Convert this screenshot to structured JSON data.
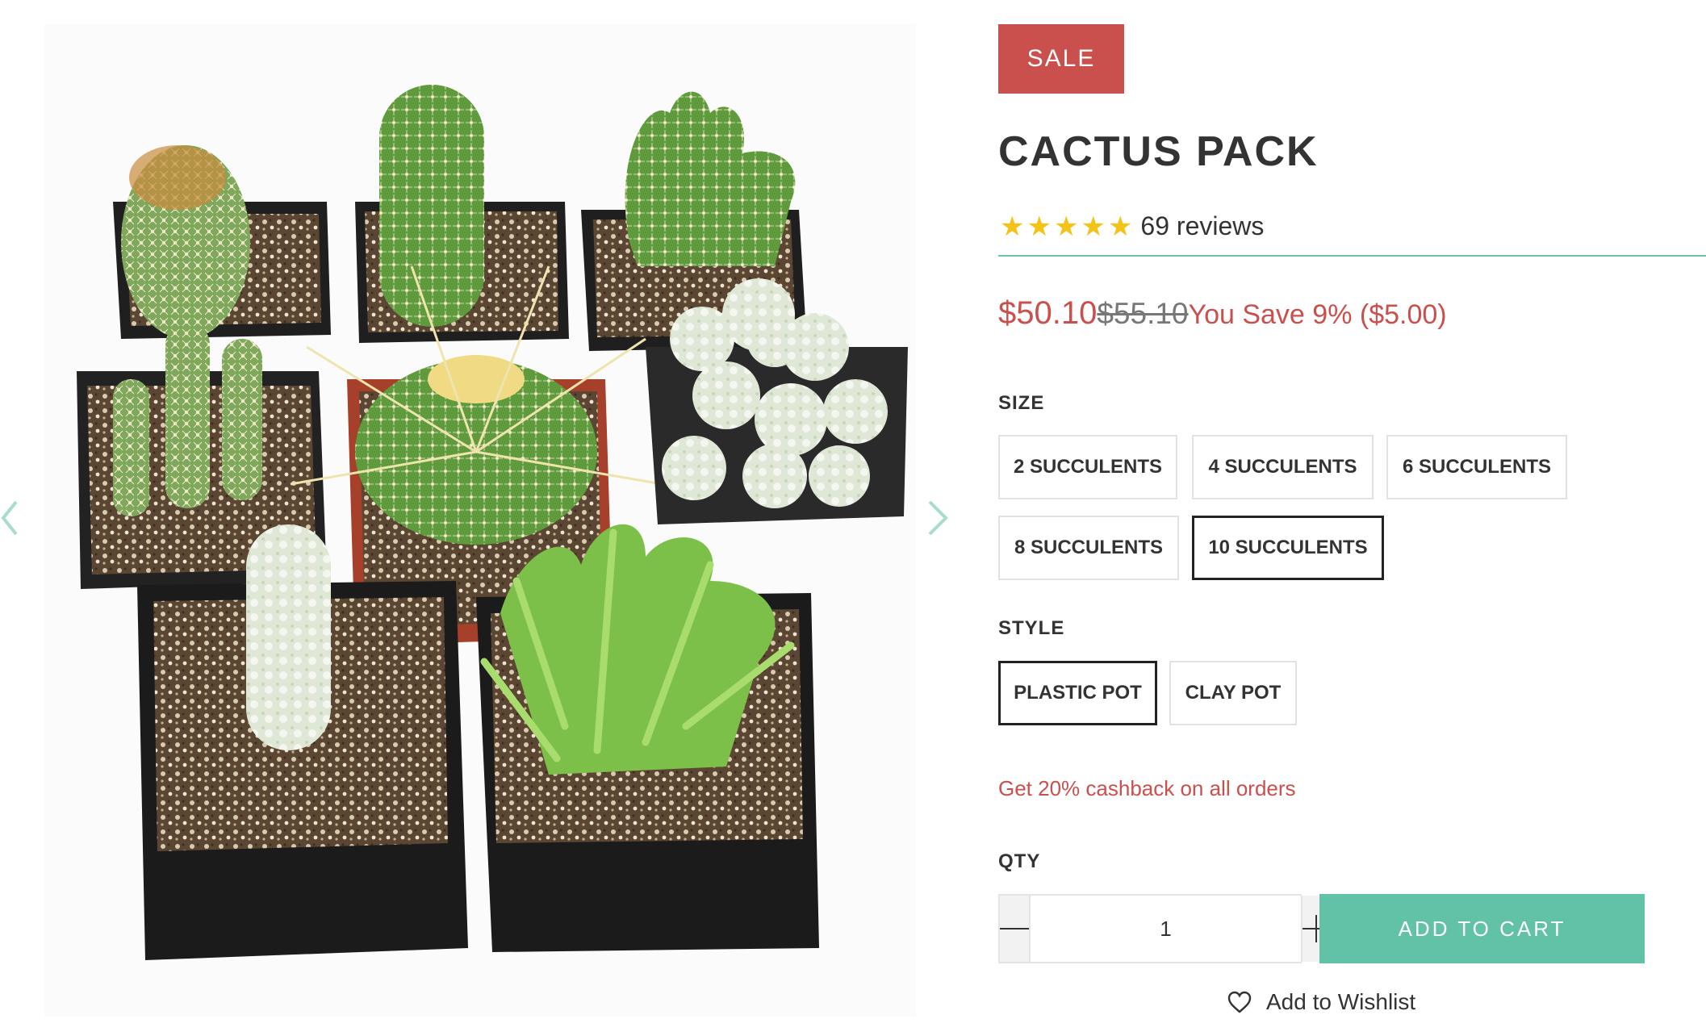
{
  "product": {
    "badge": "SALE",
    "title": "CACTUS PACK",
    "rating": {
      "stars": 5,
      "reviews_text": "69 reviews"
    },
    "price": {
      "current": "$50.10",
      "compare_at": "$55.10",
      "savings": "You Save 9% ($5.00)"
    },
    "options": {
      "size": {
        "label": "SIZE",
        "values": [
          "2 SUCCULENTS",
          "4 SUCCULENTS",
          "6 SUCCULENTS",
          "8 SUCCULENTS",
          "10 SUCCULENTS"
        ],
        "selected": "10 SUCCULENTS"
      },
      "style": {
        "label": "STYLE",
        "values": [
          "PLASTIC POT",
          "CLAY POT"
        ],
        "selected": "PLASTIC POT"
      }
    },
    "promo": "Get 20% cashback on all orders",
    "qty": {
      "label": "QTY",
      "value": "1"
    },
    "add_to_cart": "ADD TO CART",
    "wishlist": "Add to Wishlist"
  },
  "gallery": {
    "image_icon": "cactus-pack-photo",
    "prev_icon": "chevron-left-icon",
    "next_icon": "chevron-right-icon"
  },
  "colors": {
    "sale": "#c9504d",
    "accent": "#62c2a7",
    "star": "#f4c318",
    "text": "#333333"
  }
}
